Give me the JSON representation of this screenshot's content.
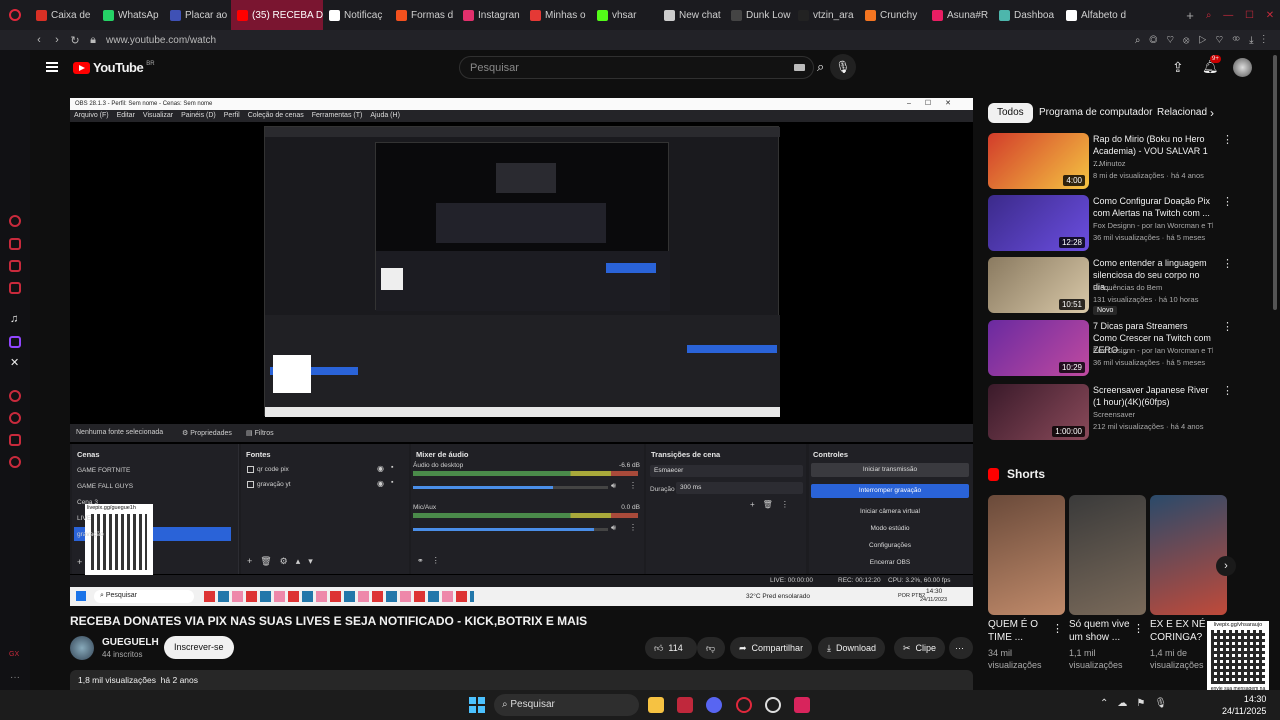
{
  "browser": {
    "tabs": [
      {
        "label": "Caixa de",
        "color": "#d93025"
      },
      {
        "label": "WhatsAp",
        "color": "#25d366"
      },
      {
        "label": "Placar ao",
        "color": "#3f51b5"
      },
      {
        "label": "(35) RECEBA D",
        "color": "#ff0000",
        "active": true
      },
      {
        "label": "Notificaç",
        "color": "#ffffff"
      },
      {
        "label": "Formas d",
        "color": "#f4511e"
      },
      {
        "label": "Instagran",
        "color": "#e1306c"
      },
      {
        "label": "Minhas o",
        "color": "#e53935"
      },
      {
        "label": "vhsar",
        "color": "#53fc18"
      },
      {
        "label": "New chat",
        "color": "#cccccc"
      },
      {
        "label": "Dunk Low",
        "color": "#444444"
      },
      {
        "label": "vtzin_ara",
        "color": "#222222"
      },
      {
        "label": "Crunchy",
        "color": "#f47521"
      },
      {
        "label": "Asuna#R",
        "color": "#e91e63"
      },
      {
        "label": "Dashboa",
        "color": "#4db6ac"
      },
      {
        "label": "Alfabeto d",
        "color": "#ffffff"
      }
    ],
    "url": "www.youtube.com/watch"
  },
  "youtube": {
    "logo_text": "YouTube",
    "region": "BR",
    "search_placeholder": "Pesquisar",
    "notif_count": "9+"
  },
  "obs": {
    "window_title": "OBS 28.1.3 - Perfil: Sem nome - Cenas: Sem nome",
    "menu": [
      "Arquivo (F)",
      "Editar",
      "Visualizar",
      "Painéis (D)",
      "Perfil",
      "Coleção de cenas",
      "Ferramentas (T)",
      "Ajuda (H)"
    ],
    "no_source": "Nenhuma fonte selecionada",
    "properties": "Propriedades",
    "filters": "Filtros",
    "scenes_title": "Cenas",
    "scenes": [
      "GAME FORTNITE",
      "GAME FALL GUYS",
      "Cena 3",
      "LIVE",
      "gravação"
    ],
    "sources_title": "Fontes",
    "sources": [
      "qr code pix",
      "gravação yt"
    ],
    "mixer_title": "Mixer de áudio",
    "mixer": [
      {
        "name": "Áudio do desktop",
        "db": "-6.6 dB",
        "level": 0.72
      },
      {
        "name": "Mic/Aux",
        "db": "0.0 dB",
        "level": 0.93
      }
    ],
    "transitions_title": "Transições de cena",
    "transition_value": "Esmaecer",
    "duration_label": "Duração",
    "duration_value": "300 ms",
    "controls_title": "Controles",
    "controls": [
      "Iniciar transmissão",
      "Interromper gravação",
      "Iniciar câmera virtual",
      "Modo estúdio",
      "Configurações",
      "Encerrar OBS"
    ],
    "status": {
      "live": "LIVE: 00:00:00",
      "rec": "REC: 00:12:20",
      "cpu": "CPU: 3.2%, 60.00 fps"
    },
    "qr_caption": "livepix.gg/guegue1h",
    "taskbar_search": "Pesquisar",
    "weather": "32°C  Pred ensolarado",
    "lang": "POR PTB2",
    "time": "14:30",
    "date": "24/11/2023"
  },
  "video": {
    "title": "RECEBA DONATES VIA PIX NAS SUAS LIVES E SEJA NOTIFICADO - KICK,BOTRIX E MAIS",
    "channel": "GUEGUELH",
    "subscribers": "44 inscritos",
    "subscribe_label": "Inscrever-se",
    "likes": "114",
    "share": "Compartilhar",
    "download": "Download",
    "clip": "Clipe",
    "views_line": "1,8 mil visualizações  há 2 anos"
  },
  "chips": [
    "Todos",
    "Programa de computador",
    "Relacionad"
  ],
  "recommendations": [
    {
      "title": "Rap do Mirio (Boku no Hero Academia) - VOU SALVAR 1 ...",
      "channel": "7 Minutoz",
      "meta": "8 mi de visualizações · há 4 anos",
      "duration": "4:00",
      "colors": [
        "#d23c2a",
        "#f5c542"
      ]
    },
    {
      "title": "Como Configurar Doação Pix com Alertas na Twitch com ...",
      "channel": "Fox Designn - por Ian Worcman e Thiag...",
      "meta": "36 mil visualizações · há 5 meses",
      "duration": "12:28",
      "colors": [
        "#3b2a8a",
        "#6b4ee0"
      ]
    },
    {
      "title": "Como entender a linguagem silenciosa do seu corpo no dia...",
      "channel": "Frequências do Bem",
      "meta": "131 visualizações · há 10 horas",
      "badge": "Novo",
      "duration": "10:51",
      "colors": [
        "#8a7a60",
        "#d8c8a8"
      ]
    },
    {
      "title": "7 Dicas para Streamers Como Crescer na Twitch com ZERO ...",
      "channel": "Fox Designn - por Ian Worcman e Thiag...",
      "meta": "36 mil visualizações · há 5 meses",
      "duration": "10:29",
      "colors": [
        "#6a2aa0",
        "#c04aa0"
      ]
    },
    {
      "title": "Screensaver Japanese River (1 hour)(4K)(60fps)",
      "channel": "Screensaver",
      "meta": "212 mil visualizações · há 4 anos",
      "duration": "1:00:00",
      "colors": [
        "#3a1a2a",
        "#8a4a5a"
      ]
    }
  ],
  "shorts_title": "Shorts",
  "shorts": [
    {
      "title": "QUEM É O TIME ...",
      "views": "34 mil visualizações",
      "colors": [
        "#6a4a3a",
        "#c08a6a"
      ]
    },
    {
      "title": "Só quem vive um show ...",
      "views": "1,1 mil visualizações",
      "colors": [
        "#3a3a3a",
        "#7a6a5a"
      ]
    },
    {
      "title": "EX E EX NÉ CORINGA?",
      "views": "1,4 mi de visualizações",
      "colors": [
        "#2a4a6a",
        "#c04a3a"
      ]
    }
  ],
  "qr_overlay": {
    "top": "livepix.gg/vhsaraujo",
    "bottom": "envie sua mensagem na live via pix!"
  },
  "windows": {
    "search": "Pesquisar",
    "time": "14:30",
    "date": "24/11/2025"
  }
}
